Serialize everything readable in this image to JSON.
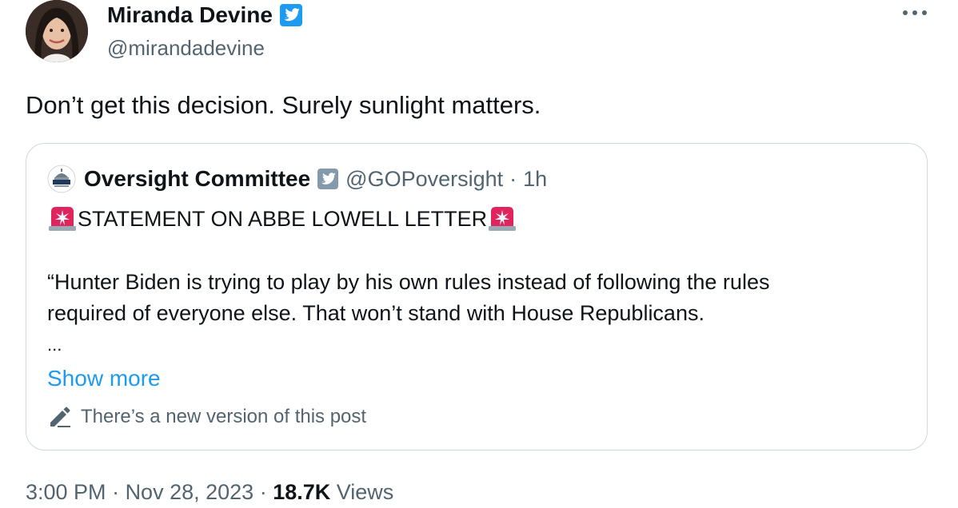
{
  "author": {
    "name": "Miranda Devine",
    "handle": "@mirandadevine",
    "verified": true
  },
  "tweet": {
    "text": "Don’t get this decision. Surely sunlight matters."
  },
  "quoted_tweet": {
    "name": "Oversight Committee",
    "handle": "@GOPoversight",
    "separator": "·",
    "time": "1h",
    "statement": "STATEMENT ON ABBE LOWELL LETTER",
    "body_line_1": "“Hunter Biden is trying to play by his own rules instead of following the rules",
    "body_line_2": "required of everyone else. That won’t stand with House Republicans.",
    "ellipsis": "...",
    "show_more": "Show more",
    "edit_note": "There’s a new version of this post"
  },
  "meta": {
    "time": "3:00 PM",
    "sep1": " · ",
    "date": "Nov 28, 2023",
    "sep2": " · ",
    "views_count": "18.7K",
    "views_label": " Views"
  },
  "colors": {
    "text": "#0f1419",
    "secondary": "#536471",
    "link": "#1d9bf0",
    "verified": "#1d9bf0",
    "border": "#cfd9de",
    "siren": "#e0245e"
  },
  "icons": [
    "avatar",
    "verified-badge-icon",
    "more-options-icon",
    "committee-logo",
    "siren-icon",
    "pencil-icon"
  ]
}
